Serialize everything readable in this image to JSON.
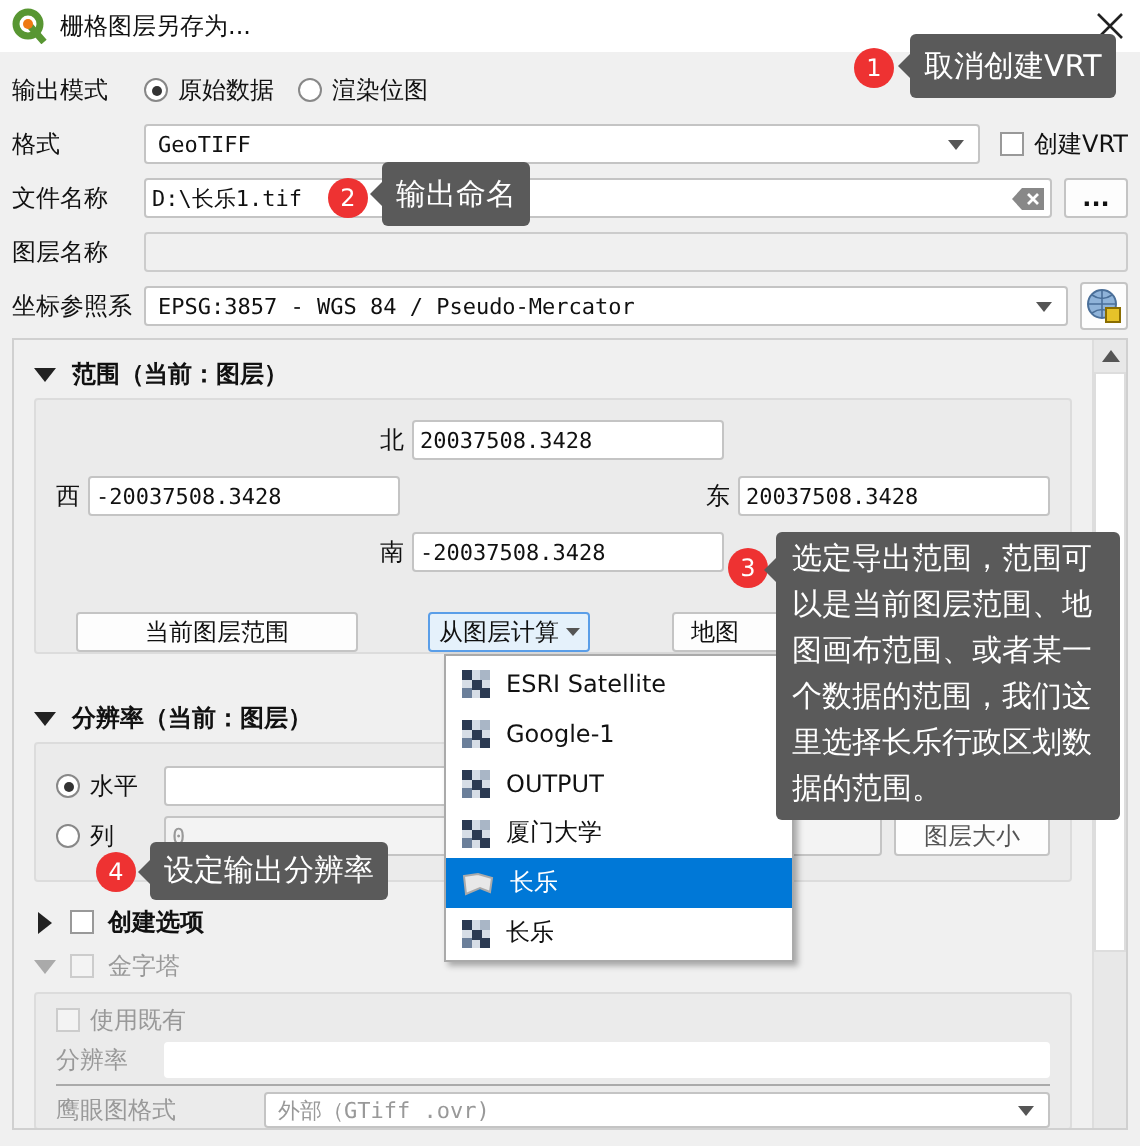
{
  "window": {
    "title": "栅格图层另存为..."
  },
  "output_mode": {
    "label": "输出模式",
    "options": [
      {
        "label": "原始数据",
        "selected": true
      },
      {
        "label": "渲染位图",
        "selected": false
      }
    ]
  },
  "format": {
    "label": "格式",
    "value": "GeoTIFF",
    "create_vrt": {
      "label": "创建VRT",
      "checked": false
    }
  },
  "file_name": {
    "label": "文件名称",
    "value": "D:\\长乐1.tif",
    "browse": "..."
  },
  "layer_name": {
    "label": "图层名称",
    "disabled": true
  },
  "crs": {
    "label": "坐标参照系",
    "value": "EPSG:3857 - WGS 84 / Pseudo-Mercator"
  },
  "extent": {
    "title": "范围（当前：图层）",
    "expanded": true,
    "north": {
      "label": "北",
      "value": "20037508.3428"
    },
    "west": {
      "label": "西",
      "value": "-20037508.3428"
    },
    "east": {
      "label": "东",
      "value": "20037508.3428"
    },
    "south": {
      "label": "南",
      "value": "-20037508.3428"
    },
    "buttons": [
      {
        "label": "当前图层范围",
        "kind": "plain",
        "open": false
      },
      {
        "label": "从图层计算",
        "kind": "menu",
        "open": true
      },
      {
        "label": "地图",
        "kind": "plain",
        "open": false
      }
    ]
  },
  "layer_menu": [
    {
      "label": "ESRI Satellite",
      "kind": "raster",
      "selected": false
    },
    {
      "label": "Google-1",
      "kind": "raster",
      "selected": false
    },
    {
      "label": "OUTPUT",
      "kind": "raster",
      "selected": false
    },
    {
      "label": "厦门大学",
      "kind": "raster",
      "selected": false
    },
    {
      "label": "长乐",
      "kind": "vector",
      "selected": true
    },
    {
      "label": "长乐",
      "kind": "raster",
      "selected": false
    }
  ],
  "resolution": {
    "title": "分辨率（当前：图层）",
    "expanded": true,
    "options": [
      {
        "label": "水平",
        "selected": true
      },
      {
        "label": "列",
        "selected": false,
        "value": "0",
        "button": "图层大小"
      }
    ]
  },
  "create_options": {
    "label": "创建选项",
    "expanded": false,
    "checked": false
  },
  "pyramids": {
    "label": "金字塔",
    "expanded": true,
    "checked": false,
    "disabled": true,
    "use_existing": {
      "label": "使用既有",
      "checked": false
    },
    "resolution_label": "分辨率",
    "overview_format": {
      "label": "鹰眼图格式",
      "value": "外部（GTiff .ovr)"
    }
  },
  "annotations": [
    {
      "number": "1",
      "text": "取消创建VRT"
    },
    {
      "number": "2",
      "text": "输出命名"
    },
    {
      "number": "3",
      "text": "选定导出范围，范围可以是当前图层范围、地图画布范围、或者某一个数据的范围，我们这里选择长乐行政区划数据的范围。"
    },
    {
      "number": "4",
      "text": "设定输出分辨率"
    }
  ]
}
